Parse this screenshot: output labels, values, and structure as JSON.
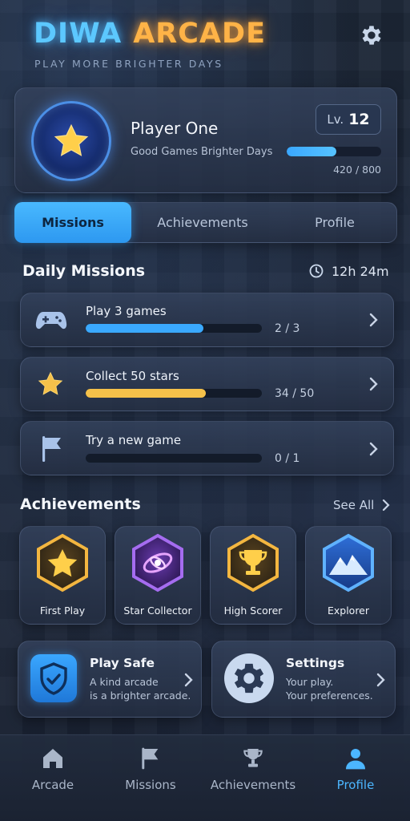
{
  "header": {
    "title_part1": "DIWA",
    "title_part2": "ARCADE",
    "tagline": "PLAY MORE BRIGHTER DAYS",
    "settings_icon": "gear-icon"
  },
  "profile": {
    "name": "Player One",
    "motto": "Good Games Brighter Days",
    "level_label": "Lv.",
    "level": "12",
    "xp_text": "420 / 800",
    "xp_fraction": 0.525,
    "avatar_icon": "star-icon"
  },
  "tabs": [
    {
      "label": "Missions",
      "active": true
    },
    {
      "label": "Achievements",
      "active": false
    },
    {
      "label": "Profile",
      "active": false
    }
  ],
  "daily": {
    "title": "Daily Missions",
    "timer": "12h 24m",
    "missions": [
      {
        "label": "Play 3 games",
        "count": "2 / 3",
        "progress": 0.667,
        "icon": "gamepad-icon",
        "color": "#3aa9ff"
      },
      {
        "label": "Collect 50 stars",
        "count": "34 / 50",
        "progress": 0.68,
        "icon": "star-icon",
        "color": "#f5c14a"
      },
      {
        "label": "Try a new game",
        "count": "0 / 1",
        "progress": 0,
        "icon": "flag-icon",
        "color": "#3aa9ff"
      }
    ]
  },
  "achievements": {
    "title": "Achievements",
    "see_all": "See All",
    "items": [
      {
        "label": "First Play",
        "icon": "star-badge-icon"
      },
      {
        "label": "Star Collector",
        "icon": "galaxy-badge-icon"
      },
      {
        "label": "High Scorer",
        "icon": "trophy-badge-icon"
      },
      {
        "label": "Explorer",
        "icon": "mountain-badge-icon"
      }
    ]
  },
  "cards": {
    "play_safe": {
      "title": "Play Safe",
      "line1": "A kind arcade",
      "line2": "is a brighter arcade."
    },
    "settings": {
      "title": "Settings",
      "line1": "Your play.",
      "line2": "Your preferences."
    }
  },
  "nav": [
    {
      "label": "Arcade",
      "icon": "home-icon"
    },
    {
      "label": "Missions",
      "icon": "flag-icon"
    },
    {
      "label": "Achievements",
      "icon": "trophy-icon"
    },
    {
      "label": "Profile",
      "icon": "person-icon",
      "active": true
    }
  ],
  "colors": {
    "accent_blue": "#3aa7ff",
    "accent_gold": "#f5c14a",
    "title_blue": "#5cc8ff",
    "title_orange": "#ffb347"
  }
}
